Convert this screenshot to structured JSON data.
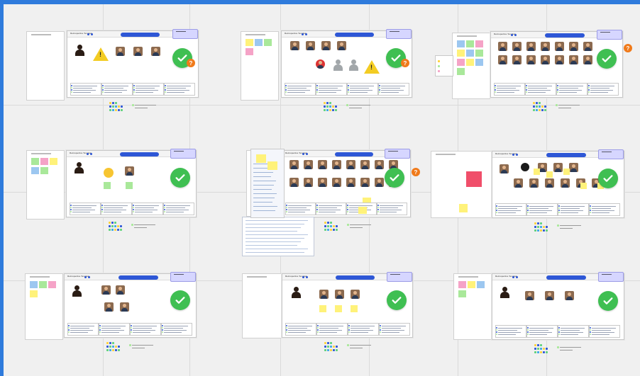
{
  "window": {
    "frame_color": "#2f7bdc",
    "canvas_color": "#f0f0f0"
  },
  "boards": [
    {
      "name": "frame-1",
      "title": "Retrospective Template"
    },
    {
      "name": "frame-2",
      "title": "Retrospective Template"
    },
    {
      "name": "frame-3",
      "title": "Retrospective Template"
    },
    {
      "name": "frame-4",
      "title": "Retrospective Template"
    },
    {
      "name": "frame-5",
      "title": "Retrospective Template"
    },
    {
      "name": "frame-6",
      "title": "Retrospective Template"
    },
    {
      "name": "frame-7",
      "title": "Retrospective Template"
    },
    {
      "name": "frame-8",
      "title": "Retrospective Template"
    },
    {
      "name": "frame-9",
      "title": "Retrospective Template"
    }
  ],
  "icons": {
    "check": "check-circle-icon",
    "question": "question-icon",
    "warning": "warning-icon"
  },
  "colors": {
    "check": "#3fbf52",
    "question": "#f07a1a",
    "blue": "#2e57d6",
    "sticky_yellow": "#fff27a",
    "sticky_pink": "#f5a3c7",
    "sticky_blue": "#9cc7f0",
    "sticky_green": "#a9e89a"
  },
  "labels": {
    "question_mark": "?",
    "warning_mark": "!"
  }
}
